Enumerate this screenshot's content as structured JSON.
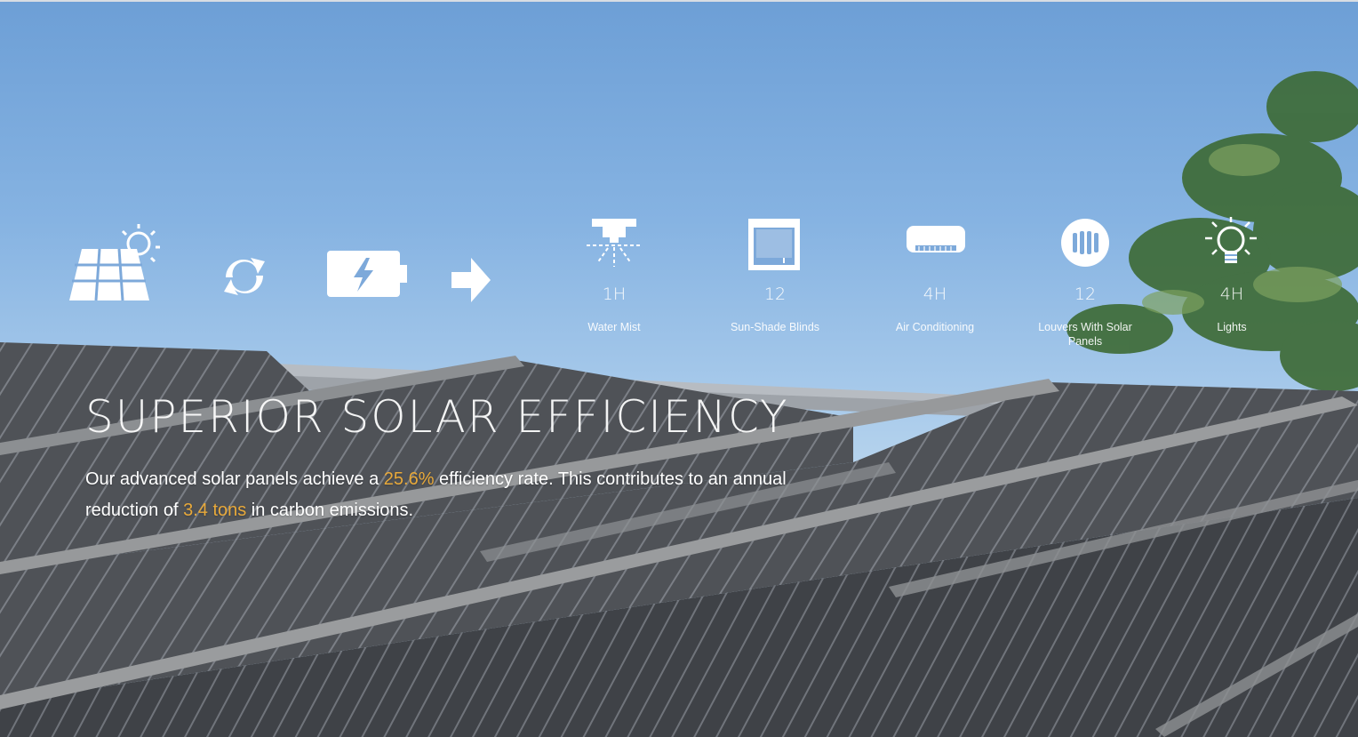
{
  "hero": {
    "title": "SUPERIOR SOLAR EFFICIENCY",
    "text": {
      "part1": "Our advanced solar panels achieve a ",
      "highlight1": "25.6%",
      "part2": " efficiency rate. This contributes to an annual reduction of ",
      "highlight2": "3.4 tons",
      "part3": " in carbon emissions."
    },
    "highlight_color": "#e8a93a"
  },
  "flow_icons": [
    {
      "icon": "solar-panel-sun-icon"
    },
    {
      "icon": "recycle-arrows-icon"
    },
    {
      "icon": "battery-charging-icon"
    },
    {
      "icon": "arrow-right-icon"
    }
  ],
  "stats": [
    {
      "icon": "water-mist-icon",
      "value": "1H",
      "label": "Water Mist"
    },
    {
      "icon": "blinds-icon",
      "value": "12",
      "label": "Sun-Shade Blinds"
    },
    {
      "icon": "air-conditioner-icon",
      "value": "4H",
      "label": "Air Conditioning"
    },
    {
      "icon": "louvers-icon",
      "value": "12",
      "label": "Louvers With Solar Panels"
    },
    {
      "icon": "light-bulb-icon",
      "value": "4H",
      "label": "Lights"
    }
  ]
}
